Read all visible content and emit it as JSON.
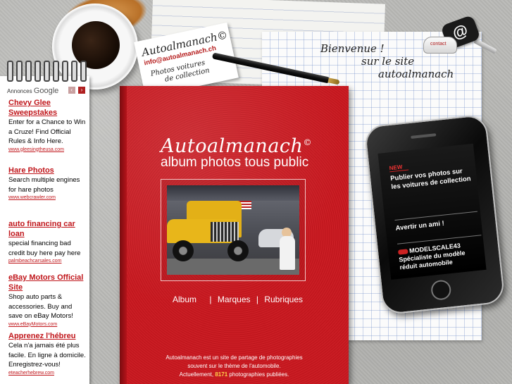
{
  "ads": {
    "header_label": "Annonces",
    "provider": "Google",
    "prev_label": "‹",
    "next_label": "›",
    "items": [
      {
        "title": "Chevy Glee Sweepstakes",
        "body": "Enter for a Chance to Win a Cruze! Find Official Rules & Info Here.",
        "url": "www.gleesingtheusa.com"
      },
      {
        "title": "Hare Photos",
        "body": "Search multiple engines for hare photos",
        "url": "www.webcrawler.com"
      },
      {
        "title": "auto financing car loan",
        "body": "special financing bad credit buy here pay here",
        "url": "palmbeachcarsales.com"
      },
      {
        "title": "eBay Motors Official Site",
        "body": "Shop auto parts & accessories. Buy and save on eBay Motors!",
        "url": "www.eBayMotors.com"
      },
      {
        "title": "Apprenez l'hébreu",
        "body": "Cela n'a jamais été plus facile. En ligne à domicile. Enregistrez-vous!",
        "url": "eteacherhebrew.com"
      }
    ]
  },
  "note": {
    "brand": "Autoalmanach©",
    "email": "info@autoalmanach.ch",
    "tagline_1": "Photos voitures",
    "tagline_2": "de collection"
  },
  "welcome": {
    "line1": "Bienvenue !",
    "line2": "sur le site",
    "line3": "autoalmanach"
  },
  "contact": {
    "label": "contact",
    "icon": "@"
  },
  "album": {
    "title": "Autoalmanach",
    "copyright": "©",
    "subtitle": "album photos tous public",
    "nav": [
      "Album",
      "Marques",
      "Rubriques"
    ],
    "info_1": "Autoalmanach est un site de partage de photographies",
    "info_2": "souvent sur le thème de l'automobile.",
    "info_3_prefix": "Actuellement,",
    "photo_count": "8171",
    "info_3_suffix": "photographies publiées."
  },
  "phone": {
    "badge": "NEW",
    "promo": "Publier vos photos sur les voitures de collection",
    "friend": "Avertir un ami !",
    "partner_name": "MODELSCALE43",
    "partner_desc": "Spécialiste du modèle réduit automobile"
  },
  "colors": {
    "album_red": "#c8161d",
    "ad_link_red": "#c0161b",
    "count_yellow": "#ffd24a"
  }
}
